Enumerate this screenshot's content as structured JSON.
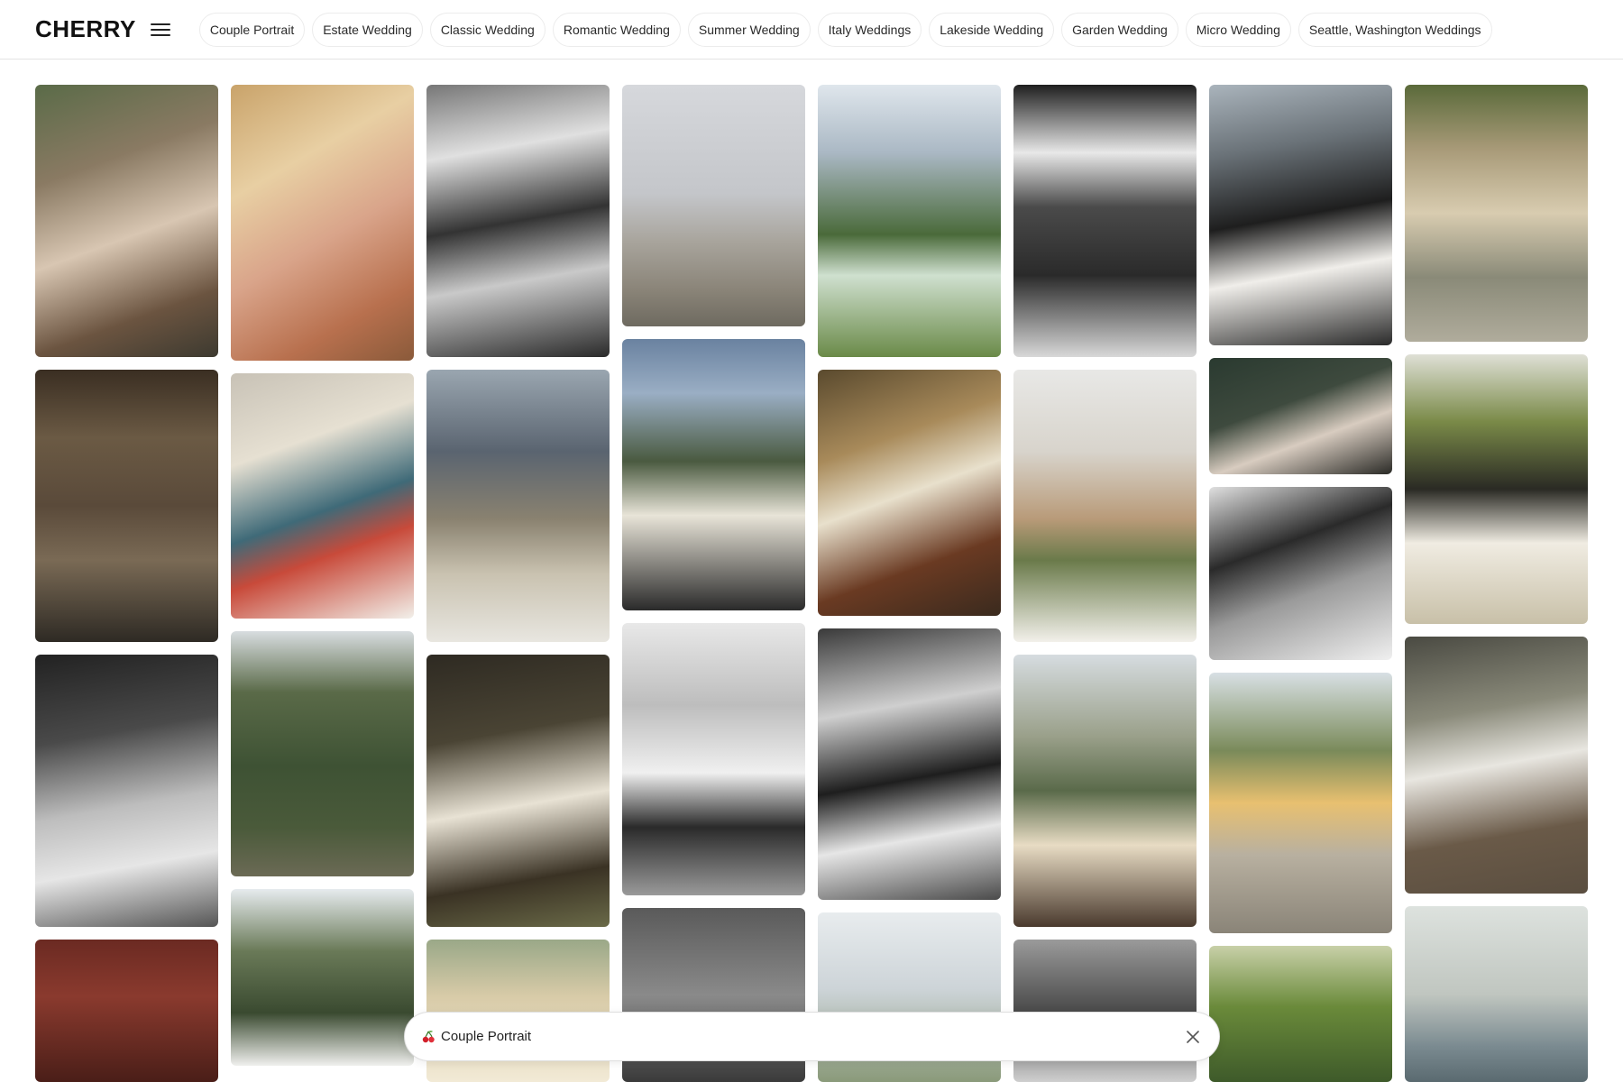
{
  "header": {
    "logo": "CHERRY",
    "menu_icon": "hamburger-menu-icon",
    "categories": [
      "Couple Portrait",
      "Estate Wedding",
      "Classic Wedding",
      "Romantic Wedding",
      "Summer Wedding",
      "Italy Weddings",
      "Lakeside Wedding",
      "Garden Wedding",
      "Micro Wedding",
      "Seattle, Washington Weddings"
    ]
  },
  "bottom_bar": {
    "label": "Couple Portrait",
    "icon": "cherry-icon",
    "close_icon": "close-icon"
  }
}
